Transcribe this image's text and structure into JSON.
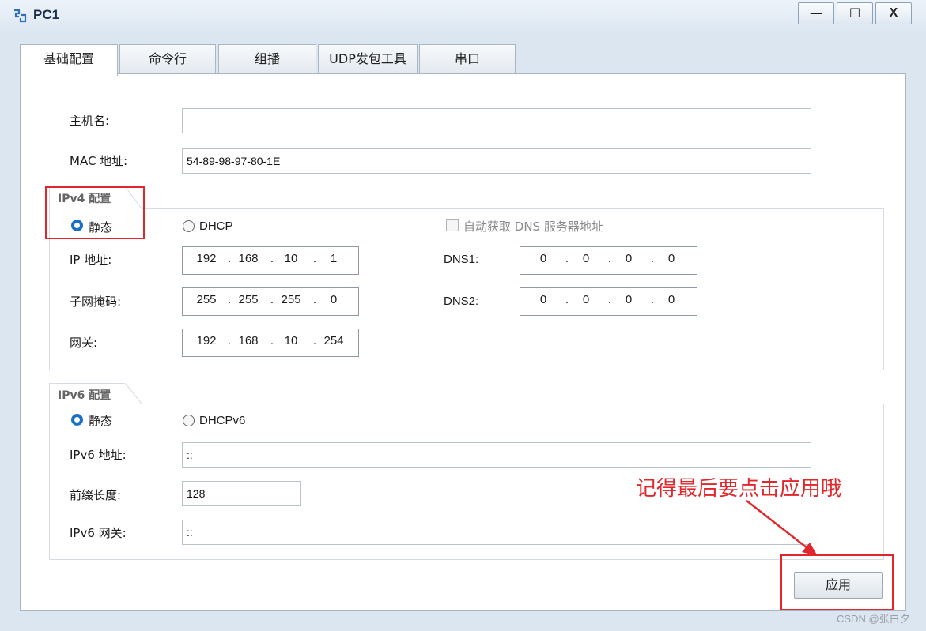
{
  "window": {
    "title": "PC1",
    "minimize_label": "—",
    "maximize_label": "☐",
    "close_label": "X"
  },
  "tabs": [
    {
      "label": "基础配置",
      "active": true
    },
    {
      "label": "命令行",
      "active": false
    },
    {
      "label": "组播",
      "active": false
    },
    {
      "label": "UDP发包工具",
      "active": false
    },
    {
      "label": "串口",
      "active": false
    }
  ],
  "basic": {
    "hostname_label": "主机名:",
    "hostname_value": "",
    "mac_label": "MAC 地址:",
    "mac_value": "54-89-98-97-80-1E"
  },
  "ipv4": {
    "group_title": "IPv4 配置",
    "static_label": "静态",
    "dhcp_label": "DHCP",
    "mode": "static",
    "auto_dns_label": "自动获取 DNS 服务器地址",
    "auto_dns_checked": false,
    "ip_label": "IP 地址:",
    "ip": [
      "192",
      "168",
      "10",
      "1"
    ],
    "mask_label": "子网掩码:",
    "mask": [
      "255",
      "255",
      "255",
      "0"
    ],
    "gateway_label": "网关:",
    "gateway": [
      "192",
      "168",
      "10",
      "254"
    ],
    "dns1_label": "DNS1:",
    "dns1": [
      "0",
      "0",
      "0",
      "0"
    ],
    "dns2_label": "DNS2:",
    "dns2": [
      "0",
      "0",
      "0",
      "0"
    ]
  },
  "ipv6": {
    "group_title": "IPv6 配置",
    "static_label": "静态",
    "dhcp_label": "DHCPv6",
    "mode": "static",
    "addr_label": "IPv6 地址:",
    "addr_value": "::",
    "prefix_label": "前缀长度:",
    "prefix_value": "128",
    "gateway_label": "IPv6 网关:",
    "gateway_value": "::"
  },
  "apply_label": "应用",
  "annotation_text": "记得最后要点击应用哦",
  "watermark": "CSDN @张白夕",
  "colors": {
    "annotation_red": "#e0272b",
    "radio_blue": "#1c6fc9",
    "window_bg": "#dbe6f1"
  }
}
